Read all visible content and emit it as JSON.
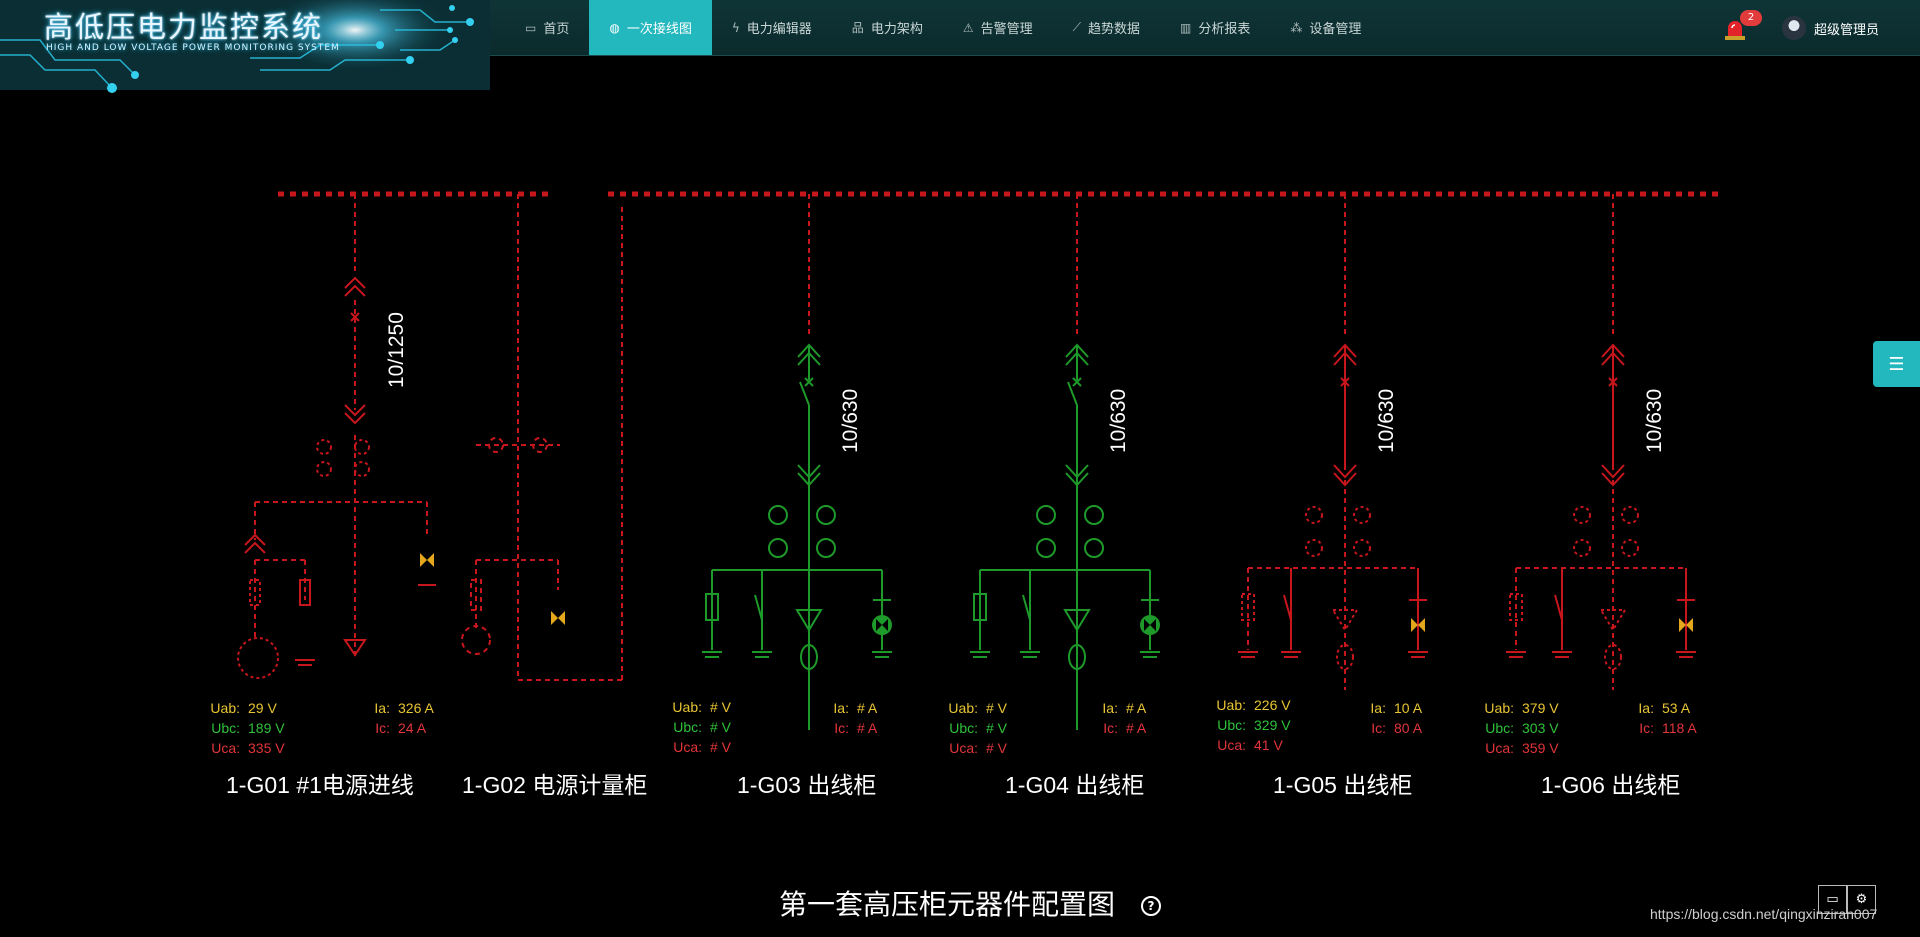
{
  "app": {
    "title": "高低压电力监控系统",
    "subtitle": "HIGH AND LOW VOLTAGE POWER MONITORING SYSTEM"
  },
  "nav": {
    "items": [
      {
        "label": "首页",
        "icon": "monitor-icon"
      },
      {
        "label": "一次接线图",
        "icon": "globe-icon",
        "active": true
      },
      {
        "label": "电力编辑器",
        "icon": "lightning-icon"
      },
      {
        "label": "电力架构",
        "icon": "hierarchy-icon"
      },
      {
        "label": "告警管理",
        "icon": "alarm-icon"
      },
      {
        "label": "趋势数据",
        "icon": "trend-icon"
      },
      {
        "label": "分析报表",
        "icon": "bar-chart-icon"
      },
      {
        "label": "设备管理",
        "icon": "network-icon"
      }
    ]
  },
  "alarm": {
    "count": "2"
  },
  "user": {
    "name": "超级管理员"
  },
  "cabinets": [
    {
      "name": "1-G01 #1电源进线",
      "rating": "10/1250",
      "voltages": [
        {
          "k": "Uab:",
          "v": "29 V"
        },
        {
          "k": "Ubc:",
          "v": "189 V"
        },
        {
          "k": "Uca:",
          "v": "335 V"
        }
      ],
      "currents": [
        {
          "k": "Ia:",
          "v": "326 A"
        },
        {
          "k": "Ic:",
          "v": "24 A"
        }
      ]
    },
    {
      "name": "1-G02 电源计量柜"
    },
    {
      "name": "1-G03 出线柜",
      "rating": "10/630",
      "voltages": [
        {
          "k": "Uab:",
          "v": "# V"
        },
        {
          "k": "Ubc:",
          "v": "# V"
        },
        {
          "k": "Uca:",
          "v": "# V"
        }
      ],
      "currents": [
        {
          "k": "Ia:",
          "v": "# A"
        },
        {
          "k": "Ic:",
          "v": "# A"
        }
      ]
    },
    {
      "name": "1-G04 出线柜",
      "rating": "10/630",
      "voltages": [
        {
          "k": "Uab:",
          "v": "# V"
        },
        {
          "k": "Ubc:",
          "v": "# V"
        },
        {
          "k": "Uca:",
          "v": "# V"
        }
      ],
      "currents": [
        {
          "k": "Ia:",
          "v": "# A"
        },
        {
          "k": "Ic:",
          "v": "# A"
        }
      ]
    },
    {
      "name": "1-G05 出线柜",
      "rating": "10/630",
      "voltages": [
        {
          "k": "Uab:",
          "v": "226 V"
        },
        {
          "k": "Ubc:",
          "v": "329 V"
        },
        {
          "k": "Uca:",
          "v": "41 V"
        }
      ],
      "currents": [
        {
          "k": "Ia:",
          "v": "10 A"
        },
        {
          "k": "Ic:",
          "v": "80 A"
        }
      ]
    },
    {
      "name": "1-G06 出线柜",
      "rating": "10/630",
      "voltages": [
        {
          "k": "Uab:",
          "v": "379 V"
        },
        {
          "k": "Ubc:",
          "v": "303 V"
        },
        {
          "k": "Uca:",
          "v": "359 V"
        }
      ],
      "currents": [
        {
          "k": "Ia:",
          "v": "53 A"
        },
        {
          "k": "Ic:",
          "v": "118 A"
        }
      ]
    }
  ],
  "diagram": {
    "title": "第一套高压柜元器件配置图"
  },
  "watermark": "https://blog.csdn.net/qingxinziran007",
  "colors": {
    "accent": "#23b7be",
    "live": "#1e9a2a",
    "dead": "#c8161d",
    "warn": "#e3a81b"
  }
}
